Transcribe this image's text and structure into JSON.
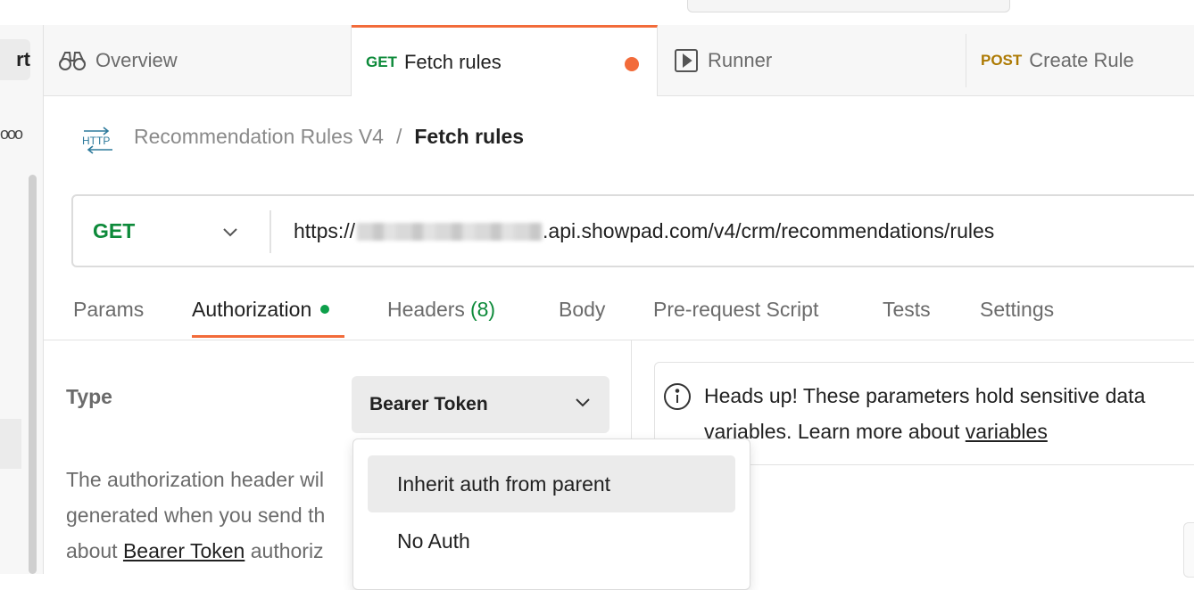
{
  "sidebar": {
    "button_label": "rt",
    "more_label": "ooo"
  },
  "tabs": [
    {
      "label": "Overview",
      "method": ""
    },
    {
      "label": "Fetch rules",
      "method": "GET"
    },
    {
      "label": "Runner",
      "method": ""
    },
    {
      "label": "Create Rule",
      "method": "POST"
    }
  ],
  "breadcrumb": {
    "collection": "Recommendation Rules V4",
    "separator": "/",
    "current": "Fetch rules",
    "icon_label": "HTTP"
  },
  "request": {
    "method": "GET",
    "url_prefix": "https://",
    "url_suffix": ".api.showpad.com/v4/crm/recommendations/rules"
  },
  "subtabs": {
    "params": "Params",
    "authorization": "Authorization",
    "headers": "Headers",
    "headers_count": "(8)",
    "body": "Body",
    "prerequest": "Pre-request Script",
    "tests": "Tests",
    "settings": "Settings"
  },
  "auth": {
    "type_label": "Type",
    "type_value": "Bearer Token",
    "desc_1": "The authorization header wil",
    "desc_2": "generated when you send th",
    "desc_3a": "about ",
    "desc_3_link": "Bearer Token",
    "desc_3b": " authoriz"
  },
  "dropdown": {
    "items": [
      "Inherit auth from parent",
      "No Auth"
    ]
  },
  "notice": {
    "line1": "Heads up! These parameters hold sensitive data",
    "line2a": "variables. Learn more about ",
    "line2_link": "variables"
  },
  "colors": {
    "accent": "#f26b3a",
    "get": "#0d8a3a",
    "post": "#ad7a03"
  }
}
